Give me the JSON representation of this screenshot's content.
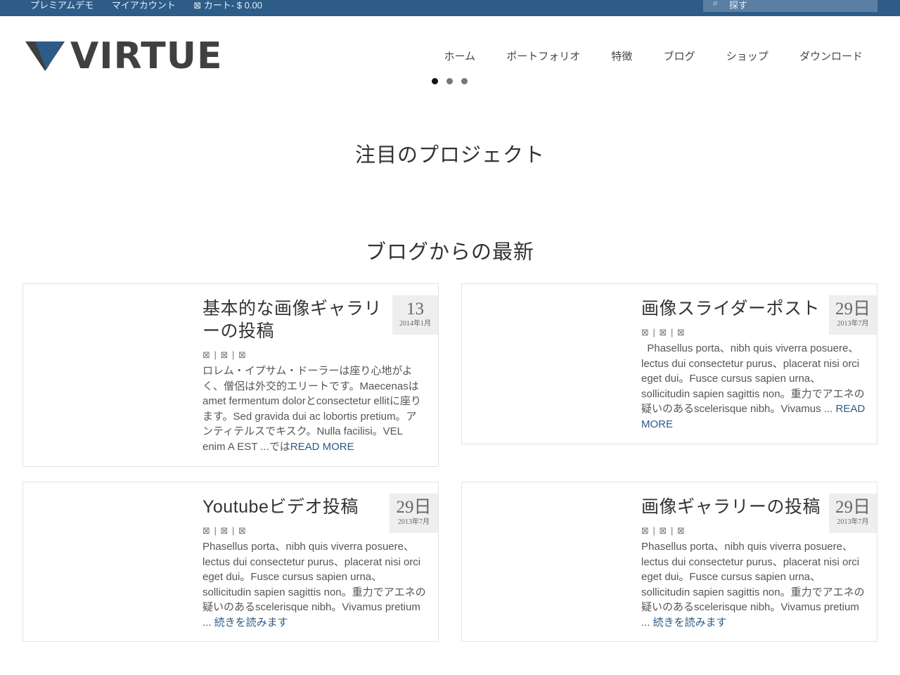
{
  "topbar": {
    "links": [
      "プレミアムデモ",
      "マイアカウント",
      "⊠ カート- $ 0.00"
    ],
    "search_icon": "search-icon",
    "search_placeholder": "探す",
    "bg_color": "#2d5c88"
  },
  "logo": {
    "text": "VIRTUE",
    "mark_color": "#2d5c88"
  },
  "nav": {
    "items": [
      "ホーム",
      "ポートフォリオ",
      "特徴",
      "ブログ",
      "ショップ",
      "ダウンロード"
    ]
  },
  "slider": {
    "dot_count": 3,
    "active_index": 0
  },
  "featured": {
    "title": "注目のプロジェクト"
  },
  "blog": {
    "title": "ブログからの最新",
    "posts": [
      {
        "title": "基本的な画像ギャラリーの投稿",
        "day": "13",
        "month": "2014年1月",
        "meta": "⊠ | ⊠ | ⊠",
        "excerpt": "ロレム・イプサム・ドーラーは座り心地がよく、僧侶は外交的エリートです。Maecenasはamet fermentum dolorとconsectetur ellitに座ります。Sed gravida dui ac lobortis pretium。アンティテルスでキスク。Nulla facilisi。VEL enim A EST ...では",
        "more": "READ MORE"
      },
      {
        "title": "画像スライダーポスト",
        "day": "29日",
        "month": "2013年7月",
        "meta": "⊠ | ⊠ | ⊠",
        "excerpt": "  Phasellus porta、nibh quis viverra posuere、lectus dui consectetur purus、placerat nisi orci eget dui。Fusce cursus sapien urna、sollicitudin sapien sagittis non。重力でアエネの疑いのあるscelerisque nibh。Vivamus ... ",
        "more": "READ MORE"
      },
      {
        "title": "Youtubeビデオ投稿",
        "day": "29日",
        "month": "2013年7月",
        "meta": "⊠ | ⊠ | ⊠",
        "excerpt": "Phasellus porta、nibh quis viverra posuere、lectus dui consectetur purus、placerat nisi orci eget dui。Fusce cursus sapien urna、sollicitudin sapien sagittis non。重力でアエネの疑いのあるscelerisque nibh。Vivamus pretium ... ",
        "more": "続きを読みます"
      },
      {
        "title": "画像ギャラリーの投稿",
        "day": "29日",
        "month": "2013年7月",
        "meta": "⊠ | ⊠ | ⊠",
        "excerpt": "Phasellus porta、nibh quis viverra posuere、lectus dui consectetur purus、placerat nisi orci eget dui。Fusce cursus sapien urna、sollicitudin sapien sagittis non。重力でアエネの疑いのあるscelerisque nibh。Vivamus pretium ... ",
        "more": "続きを読みます"
      }
    ]
  }
}
